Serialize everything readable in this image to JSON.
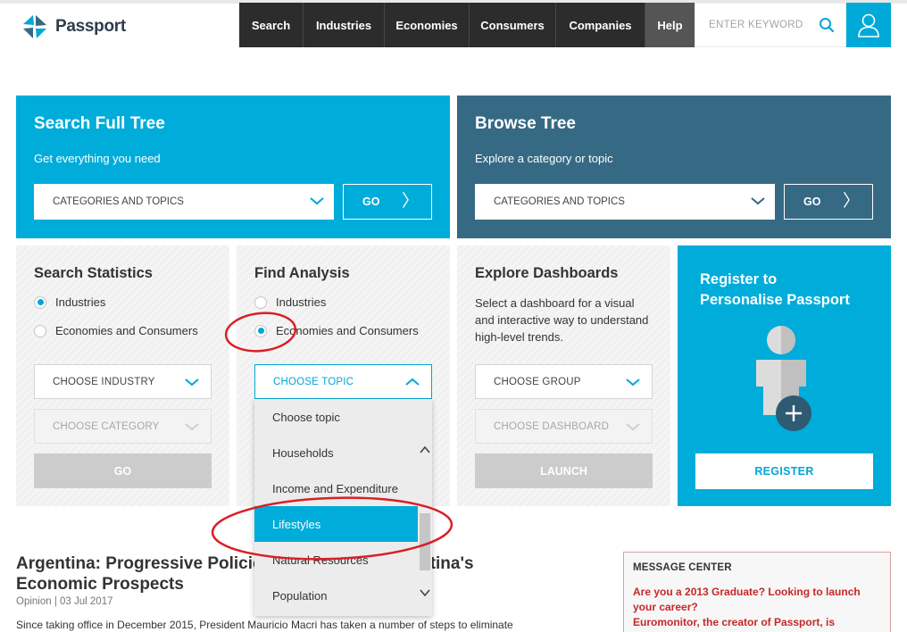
{
  "brand": {
    "name": "Passport"
  },
  "nav": {
    "items": [
      "Search",
      "Industries",
      "Economies",
      "Consumers",
      "Companies",
      "Help"
    ]
  },
  "search": {
    "placeholder": "ENTER KEYWORD"
  },
  "search_full_tree": {
    "title": "Search Full Tree",
    "subtitle": "Get everything you need",
    "select_value": "CATEGORIES AND TOPICS",
    "go_label": "GO"
  },
  "browse_tree": {
    "title": "Browse Tree",
    "subtitle": "Explore a category or topic",
    "select_value": "CATEGORIES AND TOPICS",
    "go_label": "GO"
  },
  "search_statistics": {
    "title": "Search Statistics",
    "options": [
      "Industries",
      "Economies and Consumers"
    ],
    "selected": "Industries",
    "select1": "CHOOSE INDUSTRY",
    "select2": "CHOOSE CATEGORY",
    "button": "GO"
  },
  "find_analysis": {
    "title": "Find Analysis",
    "options": [
      "Industries",
      "Economies and Consumers"
    ],
    "selected": "Economies and Consumers",
    "select1": "CHOOSE TOPIC",
    "dropdown": {
      "options": [
        "Choose topic",
        "Households",
        "Income and Expenditure",
        "Lifestyles",
        "Natural Resources",
        "Population"
      ],
      "highlighted": "Lifestyles"
    }
  },
  "explore_dashboards": {
    "title": "Explore Dashboards",
    "description": "Select a dashboard for a visual and interactive way to understand high-level trends.",
    "select1": "CHOOSE GROUP",
    "select2": "CHOOSE DASHBOARD",
    "button": "LAUNCH"
  },
  "register": {
    "title_line1": "Register to",
    "title_line2": "Personalise Passport",
    "button": "REGISTER"
  },
  "article": {
    "title_line1": "Argentina: Progressive Policies Will Improve Argentina's",
    "title_line2": "Economic Prospects",
    "meta": "Opinion | 03 Jul 2017",
    "snippet": "Since taking office in December 2015, President Mauricio Macri has taken a number of steps to eliminate"
  },
  "message_center": {
    "title": "MESSAGE CENTER",
    "line1": "Are you a 2013 Graduate? Looking to launch",
    "line2": "your career?",
    "line3": "Euromonitor, the creator of Passport, is"
  },
  "colors": {
    "accent": "#00acda",
    "teal": "#366a84",
    "nav": "#2c2c2c",
    "annotation": "#d91f26"
  },
  "icons": [
    "passport-logo-icon",
    "search-icon",
    "user-icon",
    "chevron-down-icon",
    "chevron-up-icon",
    "arrow-right-icon",
    "person-plus-icon"
  ]
}
